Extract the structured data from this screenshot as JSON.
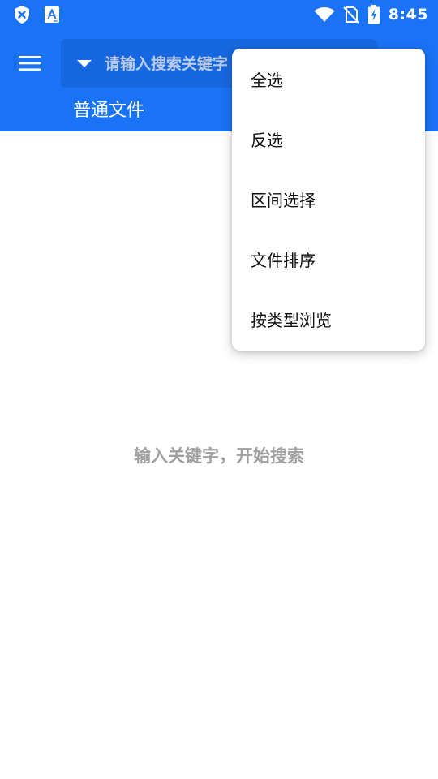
{
  "status_bar": {
    "time": "8:45",
    "icons": [
      "shield-x-icon",
      "font-a-icon",
      "wifi-icon",
      "no-sim-icon",
      "battery-charging-icon"
    ]
  },
  "toolbar": {
    "menu_icon": "hamburger-menu-icon",
    "dropdown_icon": "caret-down-icon",
    "search_placeholder": "请输入搜索关键字",
    "tab_label": "普通文件"
  },
  "empty_hint": "输入关键字，开始搜索",
  "popup_menu": {
    "items": [
      {
        "label": "全选"
      },
      {
        "label": "反选"
      },
      {
        "label": "区间选择"
      },
      {
        "label": "文件排序"
      },
      {
        "label": "按类型浏览"
      }
    ]
  },
  "colors": {
    "primary": "#1a73f5",
    "search_bg": "#1768e0",
    "hint_text": "#a0a0a0"
  }
}
